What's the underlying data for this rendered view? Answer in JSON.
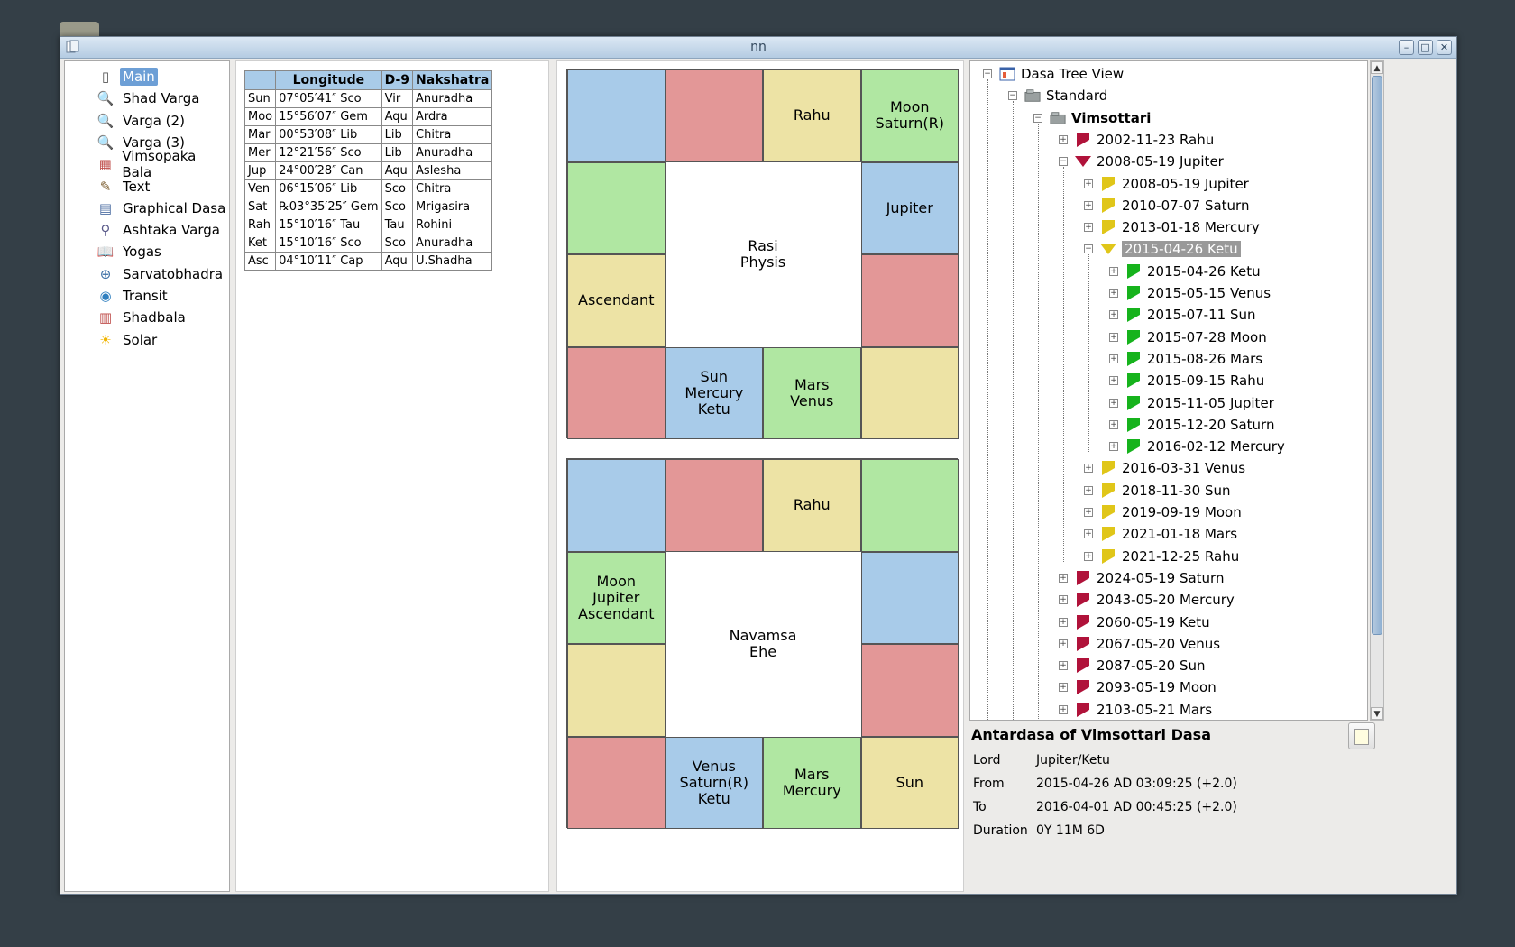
{
  "window": {
    "title": "nn"
  },
  "nav": {
    "items": [
      {
        "label": "Main",
        "icon": "page-icon",
        "selected": true
      },
      {
        "label": "Shad Varga",
        "icon": "magnifier-icon"
      },
      {
        "label": "Varga (2)",
        "icon": "magnifier-icon"
      },
      {
        "label": "Varga (3)",
        "icon": "magnifier-icon"
      },
      {
        "label": "Vimsopaka Bala",
        "icon": "chart-icon"
      },
      {
        "label": "Text",
        "icon": "text-edit-icon"
      },
      {
        "label": "Graphical Dasa",
        "icon": "graph-icon"
      },
      {
        "label": "Ashtaka Varga",
        "icon": "compass-icon"
      },
      {
        "label": "Yogas",
        "icon": "book-icon"
      },
      {
        "label": "Sarvatobhadra",
        "icon": "search-globe-icon"
      },
      {
        "label": "Transit",
        "icon": "transit-globe-icon"
      },
      {
        "label": "Shadbala",
        "icon": "bars-chart-icon"
      },
      {
        "label": "Solar",
        "icon": "sun-icon"
      }
    ]
  },
  "planets_table": {
    "headers": [
      "",
      "Longitude",
      "D-9",
      "Nakshatra"
    ],
    "rows": [
      [
        "Sun",
        "07°05′41″ Sco",
        "Vir",
        "Anuradha"
      ],
      [
        "Moo",
        "15°56′07″ Gem",
        "Aqu",
        "Ardra"
      ],
      [
        "Mar",
        "00°53′08″ Lib",
        "Lib",
        "Chitra"
      ],
      [
        "Mer",
        "12°21′56″ Sco",
        "Lib",
        "Anuradha"
      ],
      [
        "Jup",
        "24°00′28″ Can",
        "Aqu",
        "Aslesha"
      ],
      [
        "Ven",
        "06°15′06″ Lib",
        "Sco",
        "Chitra"
      ],
      [
        "Sat",
        "℞03°35′25″ Gem",
        "Sco",
        "Mrigasira"
      ],
      [
        "Rah",
        "15°10′16″ Tau",
        "Tau",
        "Rohini"
      ],
      [
        "Ket",
        "15°10′16″ Sco",
        "Sco",
        "Anuradha"
      ],
      [
        "Asc",
        "04°10′11″ Cap",
        "Aqu",
        "U.Shadha"
      ]
    ]
  },
  "rasi_chart": {
    "center": "Rasi\nPhysis",
    "cells": [
      "",
      "",
      "Rahu",
      "Moon\nSaturn(R)",
      "Jupiter",
      "",
      "",
      "Mars\nVenus",
      "Sun\nMercury\nKetu",
      "",
      "Ascendant",
      ""
    ]
  },
  "navamsa_chart": {
    "center": "Navamsa\nEhe",
    "cells": [
      "",
      "",
      "Rahu",
      "",
      "",
      "",
      "Sun",
      "Mars\nMercury",
      "Venus\nSaturn(R)\nKetu",
      "",
      "",
      "Moon\nJupiter\nAscendant"
    ]
  },
  "chart_colors": {
    "blue": "#a8cbe9",
    "red": "#e39797",
    "yellow": "#ede3a5",
    "green": "#b0e7a2"
  },
  "tree": {
    "root": "Dasa Tree View",
    "standard": "Standard",
    "vimsottari": "Vimsottari",
    "rows": [
      {
        "label": "2002-11-23 Rahu",
        "level": 3,
        "icon": "red-right-triangle-icon",
        "state": "collapsed"
      },
      {
        "label": "2008-05-19 Jupiter",
        "level": 3,
        "icon": "red-down-triangle-icon",
        "state": "expanded"
      },
      {
        "label": "2008-05-19 Jupiter",
        "level": 4,
        "icon": "yellow-right-triangle-icon",
        "state": "collapsed"
      },
      {
        "label": "2010-07-07 Saturn",
        "level": 4,
        "icon": "yellow-right-triangle-icon",
        "state": "collapsed"
      },
      {
        "label": "2013-01-18 Mercury",
        "level": 4,
        "icon": "yellow-right-triangle-icon",
        "state": "collapsed"
      },
      {
        "label": "2015-04-26 Ketu",
        "level": 4,
        "icon": "yellow-down-triangle-icon",
        "state": "expanded",
        "selected": true
      },
      {
        "label": "2015-04-26 Ketu",
        "level": 5,
        "icon": "green-right-triangle-icon",
        "state": "collapsed"
      },
      {
        "label": "2015-05-15 Venus",
        "level": 5,
        "icon": "green-right-triangle-icon",
        "state": "collapsed"
      },
      {
        "label": "2015-07-11 Sun",
        "level": 5,
        "icon": "green-right-triangle-icon",
        "state": "collapsed"
      },
      {
        "label": "2015-07-28 Moon",
        "level": 5,
        "icon": "green-right-triangle-icon",
        "state": "collapsed"
      },
      {
        "label": "2015-08-26 Mars",
        "level": 5,
        "icon": "green-right-triangle-icon",
        "state": "collapsed"
      },
      {
        "label": "2015-09-15 Rahu",
        "level": 5,
        "icon": "green-right-triangle-icon",
        "state": "collapsed"
      },
      {
        "label": "2015-11-05 Jupiter",
        "level": 5,
        "icon": "green-right-triangle-icon",
        "state": "collapsed"
      },
      {
        "label": "2015-12-20 Saturn",
        "level": 5,
        "icon": "green-right-triangle-icon",
        "state": "collapsed"
      },
      {
        "label": "2016-02-12 Mercury",
        "level": 5,
        "icon": "green-right-triangle-icon",
        "state": "collapsed"
      },
      {
        "label": "2016-03-31 Venus",
        "level": 4,
        "icon": "yellow-right-triangle-icon",
        "state": "collapsed"
      },
      {
        "label": "2018-11-30 Sun",
        "level": 4,
        "icon": "yellow-right-triangle-icon",
        "state": "collapsed"
      },
      {
        "label": "2019-09-19 Moon",
        "level": 4,
        "icon": "yellow-right-triangle-icon",
        "state": "collapsed"
      },
      {
        "label": "2021-01-18 Mars",
        "level": 4,
        "icon": "yellow-right-triangle-icon",
        "state": "collapsed"
      },
      {
        "label": "2021-12-25 Rahu",
        "level": 4,
        "icon": "yellow-right-triangle-icon",
        "state": "collapsed"
      },
      {
        "label": "2024-05-19 Saturn",
        "level": 3,
        "icon": "red-right-triangle-icon",
        "state": "collapsed"
      },
      {
        "label": "2043-05-20 Mercury",
        "level": 3,
        "icon": "red-right-triangle-icon",
        "state": "collapsed"
      },
      {
        "label": "2060-05-19 Ketu",
        "level": 3,
        "icon": "red-right-triangle-icon",
        "state": "collapsed"
      },
      {
        "label": "2067-05-20 Venus",
        "level": 3,
        "icon": "red-right-triangle-icon",
        "state": "collapsed"
      },
      {
        "label": "2087-05-20 Sun",
        "level": 3,
        "icon": "red-right-triangle-icon",
        "state": "collapsed"
      },
      {
        "label": "2093-05-19 Moon",
        "level": 3,
        "icon": "red-right-triangle-icon",
        "state": "collapsed"
      },
      {
        "label": "2103-05-21 Mars",
        "level": 3,
        "icon": "red-right-triangle-icon",
        "state": "collapsed"
      }
    ]
  },
  "details": {
    "heading": "Antardasa of Vimsottari Dasa",
    "lord_label": "Lord",
    "lord": "Jupiter/Ketu",
    "from_label": "From",
    "from": "2015-04-26 AD 03:09:25 (+2.0)",
    "to_label": "To",
    "to": "2016-04-01 AD 00:45:25 (+2.0)",
    "duration_label": "Duration",
    "duration": "0Y 11M 6D"
  }
}
